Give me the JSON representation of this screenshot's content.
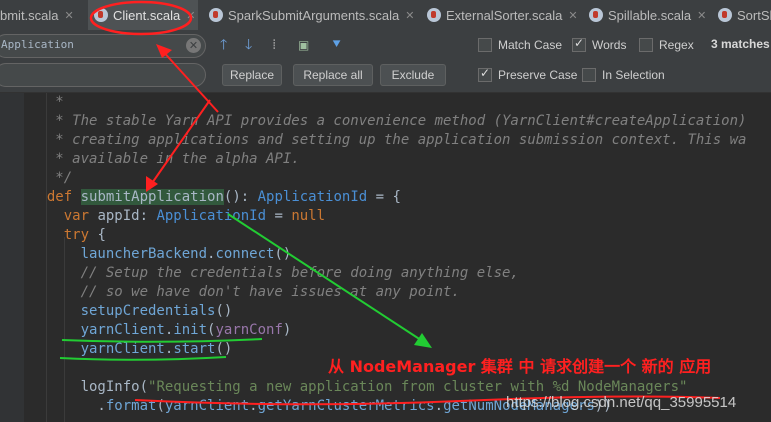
{
  "tabs": [
    {
      "label": "bmit.scala",
      "active": false
    },
    {
      "label": "Client.scala",
      "active": true
    },
    {
      "label": "SparkSubmitArguments.scala",
      "active": false
    },
    {
      "label": "ExternalSorter.scala",
      "active": false
    },
    {
      "label": "Spillable.scala",
      "active": false
    },
    {
      "label": "SortSh",
      "active": false
    }
  ],
  "find": {
    "search_value": "Application",
    "replace_value": "",
    "buttons": {
      "replace": "Replace",
      "replace_all": "Replace all",
      "exclude": "Exclude"
    },
    "options": {
      "match_case": {
        "label": "Match Case",
        "checked": false
      },
      "words": {
        "label": "Words",
        "checked": true
      },
      "regex": {
        "label": "Regex",
        "checked": false
      },
      "preserve_case": {
        "label": "Preserve Case",
        "checked": true
      },
      "in_selection": {
        "label": "In Selection",
        "checked": false
      }
    },
    "matches": "3 matches",
    "icons": [
      "arrow-up-icon",
      "arrow-down-icon",
      "add-selection-icon",
      "select-all-occurrences-icon",
      "filter-icon"
    ]
  },
  "code": {
    "lines": [
      "   *",
      "   * The stable Yarn API provides a convenience method (YarnClient#createApplication)",
      "   * creating applications and setting up the application submission context. This wa",
      "   * available in the alpha API.",
      "   */",
      "  def submitApplication(): ApplicationId = {",
      "    var appId: ApplicationId = null",
      "    try {",
      "      launcherBackend.connect()",
      "      // Setup the credentials before doing anything else,",
      "      // so we have don't have issues at any point.",
      "      setupCredentials()",
      "      yarnClient.init(yarnConf)",
      "      yarnClient.start()",
      "",
      "      logInfo(\"Requesting a new application from cluster with %d NodeManagers\"",
      "        .format(yarnClient.getYarnClusterMetrics.getNumNodeManagers))"
    ]
  },
  "annotation": "从 NodeManager 集群 中 请求创建一个  新的 应用",
  "watermark": "https://blog.csdn.net/qq_35995514",
  "colors": {
    "annotation_red": "#ff2020",
    "annotation_green": "#22cc33",
    "editor_bg": "#2b2b2b",
    "keyword": "#cc7832",
    "string": "#6a8759",
    "comment": "#808080"
  }
}
